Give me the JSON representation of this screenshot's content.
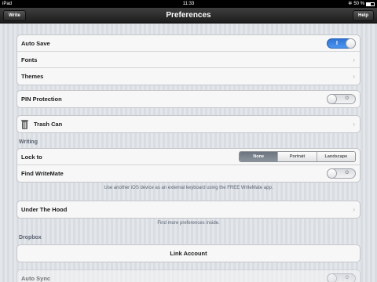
{
  "status_bar": {
    "device": "iPad",
    "time": "11:33",
    "battery": "50 %"
  },
  "nav": {
    "title": "Preferences",
    "left_button": "Write",
    "right_button": "Help"
  },
  "general": {
    "auto_save": {
      "label": "Auto Save",
      "toggle_mark": "I"
    },
    "fonts": "Fonts",
    "themes": "Themes"
  },
  "pin": {
    "label": "PIN Protection",
    "toggle_mark": "O"
  },
  "trash": {
    "label": "Trash Can"
  },
  "writing": {
    "header": "Writing",
    "lock_to": {
      "label": "Lock to",
      "options": [
        "None",
        "Portrait",
        "Landscape"
      ],
      "selected": "None"
    },
    "find_writemate": {
      "label": "Find WriteMate",
      "toggle_mark": "O"
    },
    "footnote": "Use another iOS device as an external keyboard using the FREE WriteMate app."
  },
  "under_hood": {
    "label": "Under The Hood",
    "footnote": "Find more preferences inside."
  },
  "dropbox": {
    "header": "Dropbox",
    "link_account": "Link Account"
  },
  "auto_sync": {
    "label": "Auto Sync",
    "toggle_mark": "O"
  },
  "colors": {
    "accent": "#3b82e0",
    "nav_bg": "#2a2a2a",
    "section_text": "#5a6370"
  },
  "icons": {
    "chevron": "chevron-right-icon",
    "trash": "trash-can-icon"
  }
}
